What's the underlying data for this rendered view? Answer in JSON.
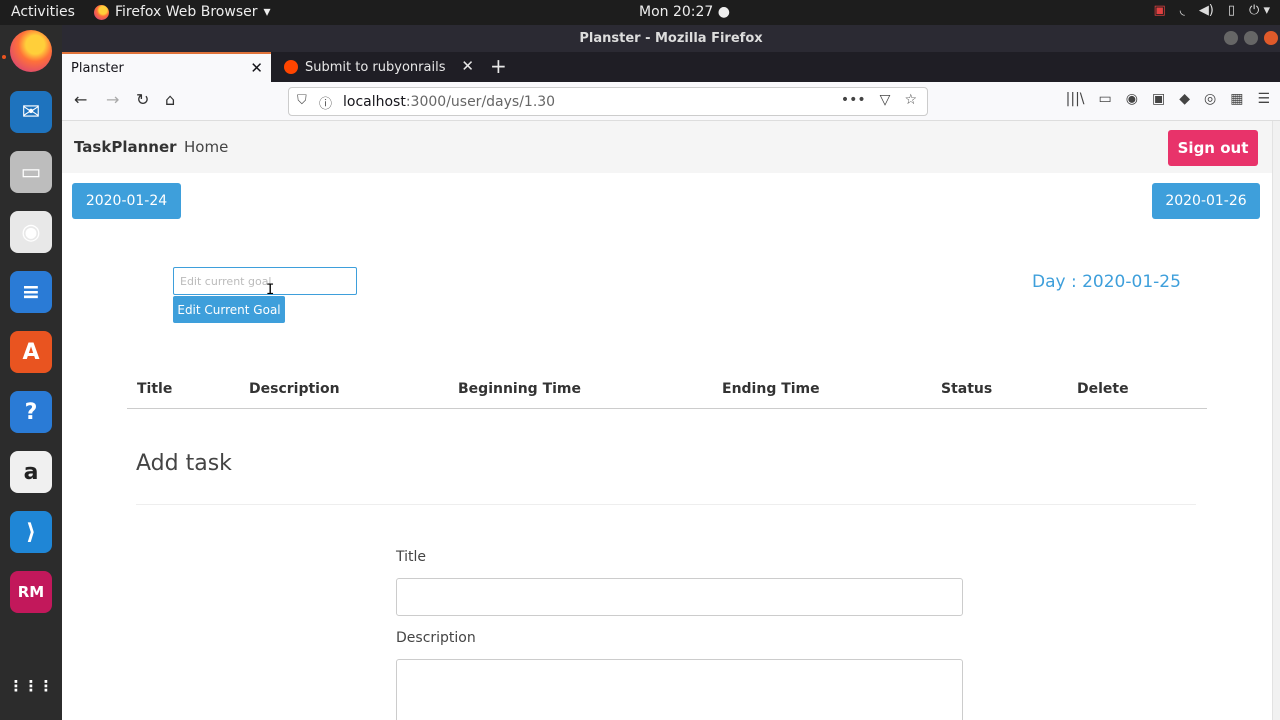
{
  "os": {
    "activities": "Activities",
    "app_name": "Firefox Web Browser",
    "app_caret": "▾",
    "clock": "Mon 20:27 ●",
    "tray_icons": [
      "camera-icon",
      "wifi-icon",
      "volume-icon",
      "battery-icon",
      "power-icon"
    ],
    "tray_glyphs": [
      "▣",
      "◟",
      "◀)",
      "▯",
      "⏻ ▾"
    ]
  },
  "dock": {
    "items": [
      {
        "name": "firefox-icon",
        "glyph": "",
        "color": "#ff7139"
      },
      {
        "name": "thunderbird-icon",
        "glyph": "✉",
        "color": "#1e73be"
      },
      {
        "name": "files-icon",
        "glyph": "▭",
        "color": "#bdbdbd"
      },
      {
        "name": "rhythmbox-icon",
        "glyph": "◉",
        "color": "#e8e8e8"
      },
      {
        "name": "writer-icon",
        "glyph": "≡",
        "color": "#2a7bd6"
      },
      {
        "name": "software-icon",
        "glyph": "A",
        "color": "#e95420"
      },
      {
        "name": "help-icon",
        "glyph": "?",
        "color": "#2a7bd6"
      },
      {
        "name": "amazon-icon",
        "glyph": "a",
        "color": "#f0f0f0"
      },
      {
        "name": "vscode-icon",
        "glyph": "⟩",
        "color": "#1f86d6"
      },
      {
        "name": "rubymine-icon",
        "glyph": "RM",
        "color": "#c2185b"
      },
      {
        "name": "apps-grid-icon",
        "glyph": "⋮⋮⋮",
        "color": "#2c2c2c"
      }
    ]
  },
  "browser": {
    "window_title": "Planster - Mozilla Firefox",
    "tabs": [
      {
        "label": "Planster",
        "close": "✕"
      },
      {
        "label": "Submit to rubyonrails",
        "close": "✕"
      }
    ],
    "new_tab": "+",
    "nav": {
      "back": "←",
      "forward": "→",
      "reload": "↻",
      "home": "⌂"
    },
    "url": {
      "host": "localhost",
      "rest": ":3000/user/days/1.30"
    },
    "url_right": [
      "•••",
      "▽",
      "☆"
    ],
    "toolbar_icons": [
      "|||\\",
      "▭",
      "◉",
      "▣",
      "◆",
      "◎",
      "▦",
      "☰"
    ]
  },
  "app": {
    "brand": "TaskPlanner",
    "home_link": "Home",
    "sign_out": "Sign out",
    "prev_day": "2020-01-24",
    "next_day": "2020-01-26",
    "goal_placeholder": "Edit current goal",
    "goal_button": "Edit Current Goal",
    "day_label": "Day : 2020-01-25",
    "table_headers": [
      "Title",
      "Description",
      "Beginning Time",
      "Ending Time",
      "Status",
      "Delete"
    ],
    "add_task_title": "Add task",
    "form": {
      "title_label": "Title",
      "description_label": "Description"
    }
  },
  "colors": {
    "accent": "#3e9fdb",
    "signout": "#e8336a"
  }
}
